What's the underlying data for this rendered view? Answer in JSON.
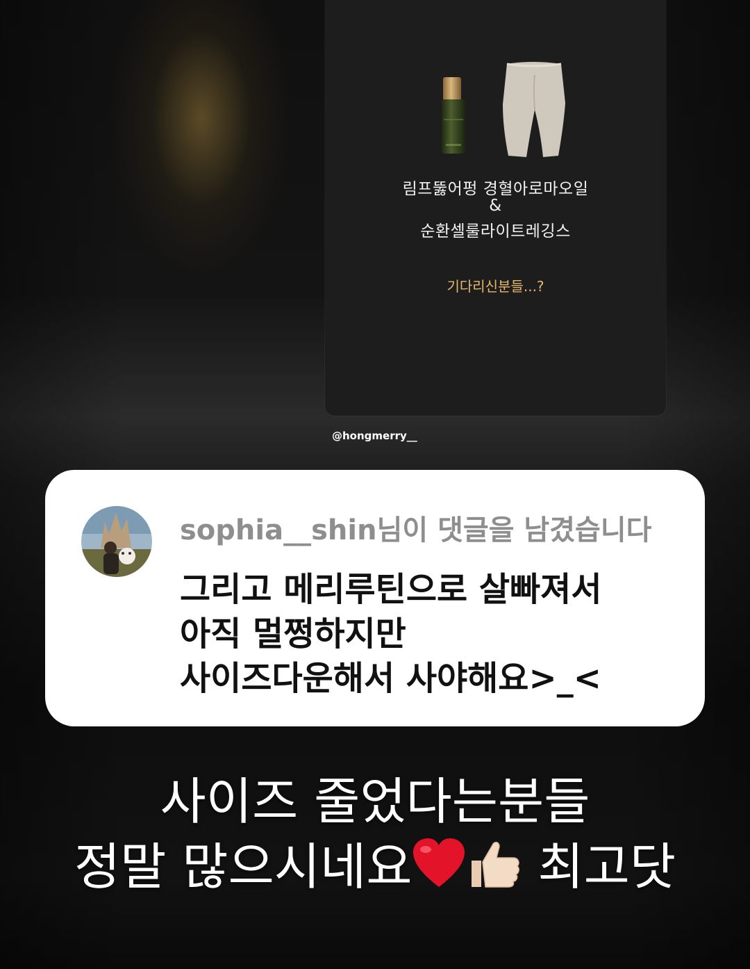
{
  "story": {
    "product_line_1": "림프뚫어펑 경혈아로마오일",
    "product_line_2": "&",
    "product_line_3": "순환셀룰라이트레깅스",
    "question": "기다리신분들...?"
  },
  "credit": "@hongmerry__",
  "comment": {
    "header": "sophia__shin님이 댓글을 남겼습니다",
    "lines": [
      "그리고 메리루틴으로 살빠져서",
      "아직 멀쩡하지만",
      "사이즈다운해서 사야해요>_<"
    ]
  },
  "caption": {
    "line_1": "사이즈 줄었다는분들",
    "line_2_text": "정말 많으시네요",
    "line_2_end": "최고닷",
    "emojis": [
      "heart-icon",
      "thumbs-up-icon"
    ]
  },
  "colors": {
    "question_accent": "#e8b86a",
    "comment_header": "#8e8e8e"
  }
}
